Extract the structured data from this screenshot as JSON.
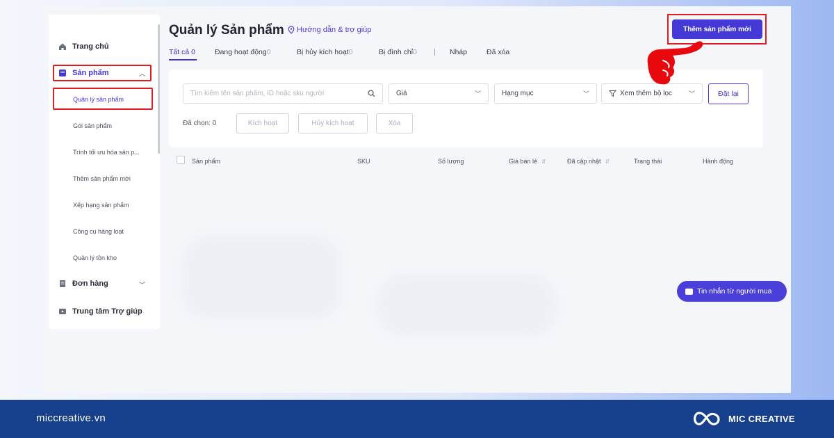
{
  "sidebar": {
    "home": "Trang chủ",
    "products": "Sản phẩm",
    "sub_items": [
      "Quản lý sản phẩm",
      "Gói sản phẩm",
      "Trình tối ưu hóa sản p...",
      "Thêm sản phẩm mới",
      "Xếp hạng sản phẩm",
      "Công cụ hàng loạt",
      "Quản lý tồn kho"
    ],
    "orders": "Đơn hàng",
    "help_center": "Trung tâm Trợ giúp"
  },
  "header": {
    "title": "Quản lý Sản phẩm",
    "help_link": "Hướng dẫn & trợ giúp",
    "add_button": "Thêm sản phẩm mới"
  },
  "tabs": [
    {
      "label": "Tất cả",
      "count": "0"
    },
    {
      "label": "Đang hoạt động",
      "count": "0"
    },
    {
      "label": "Bị hủy kích hoạt",
      "count": "0"
    },
    {
      "label": "Bị đình chỉ",
      "count": "0"
    },
    {
      "label": "Nháp",
      "count": ""
    },
    {
      "label": "Đã xóa",
      "count": ""
    }
  ],
  "filters": {
    "search_placeholder": "Tìm kiếm tên sản phẩm, ID hoặc sku người",
    "price": "Giá",
    "category": "Hạng mục",
    "more_filters": "Xem thêm bộ lọc",
    "reset": "Đặt lại",
    "selected_label": "Đã chọn: 0",
    "activate": "Kích hoạt",
    "deactivate": "Hủy kích hoạt",
    "delete": "Xóa"
  },
  "table": {
    "columns": [
      "Sản phẩm",
      "SKU",
      "Số lượng",
      "Giá bán lẻ",
      "Đã cập nhật",
      "Trạng thái",
      "Hành động"
    ]
  },
  "chat_button": "Tin nhắn từ người mua",
  "footer": {
    "site": "miccreative.vn",
    "brand": "MIC CREATIVE"
  },
  "colors": {
    "accent": "#4438d6",
    "highlight": "#e01b22",
    "footer": "#163f8c"
  }
}
